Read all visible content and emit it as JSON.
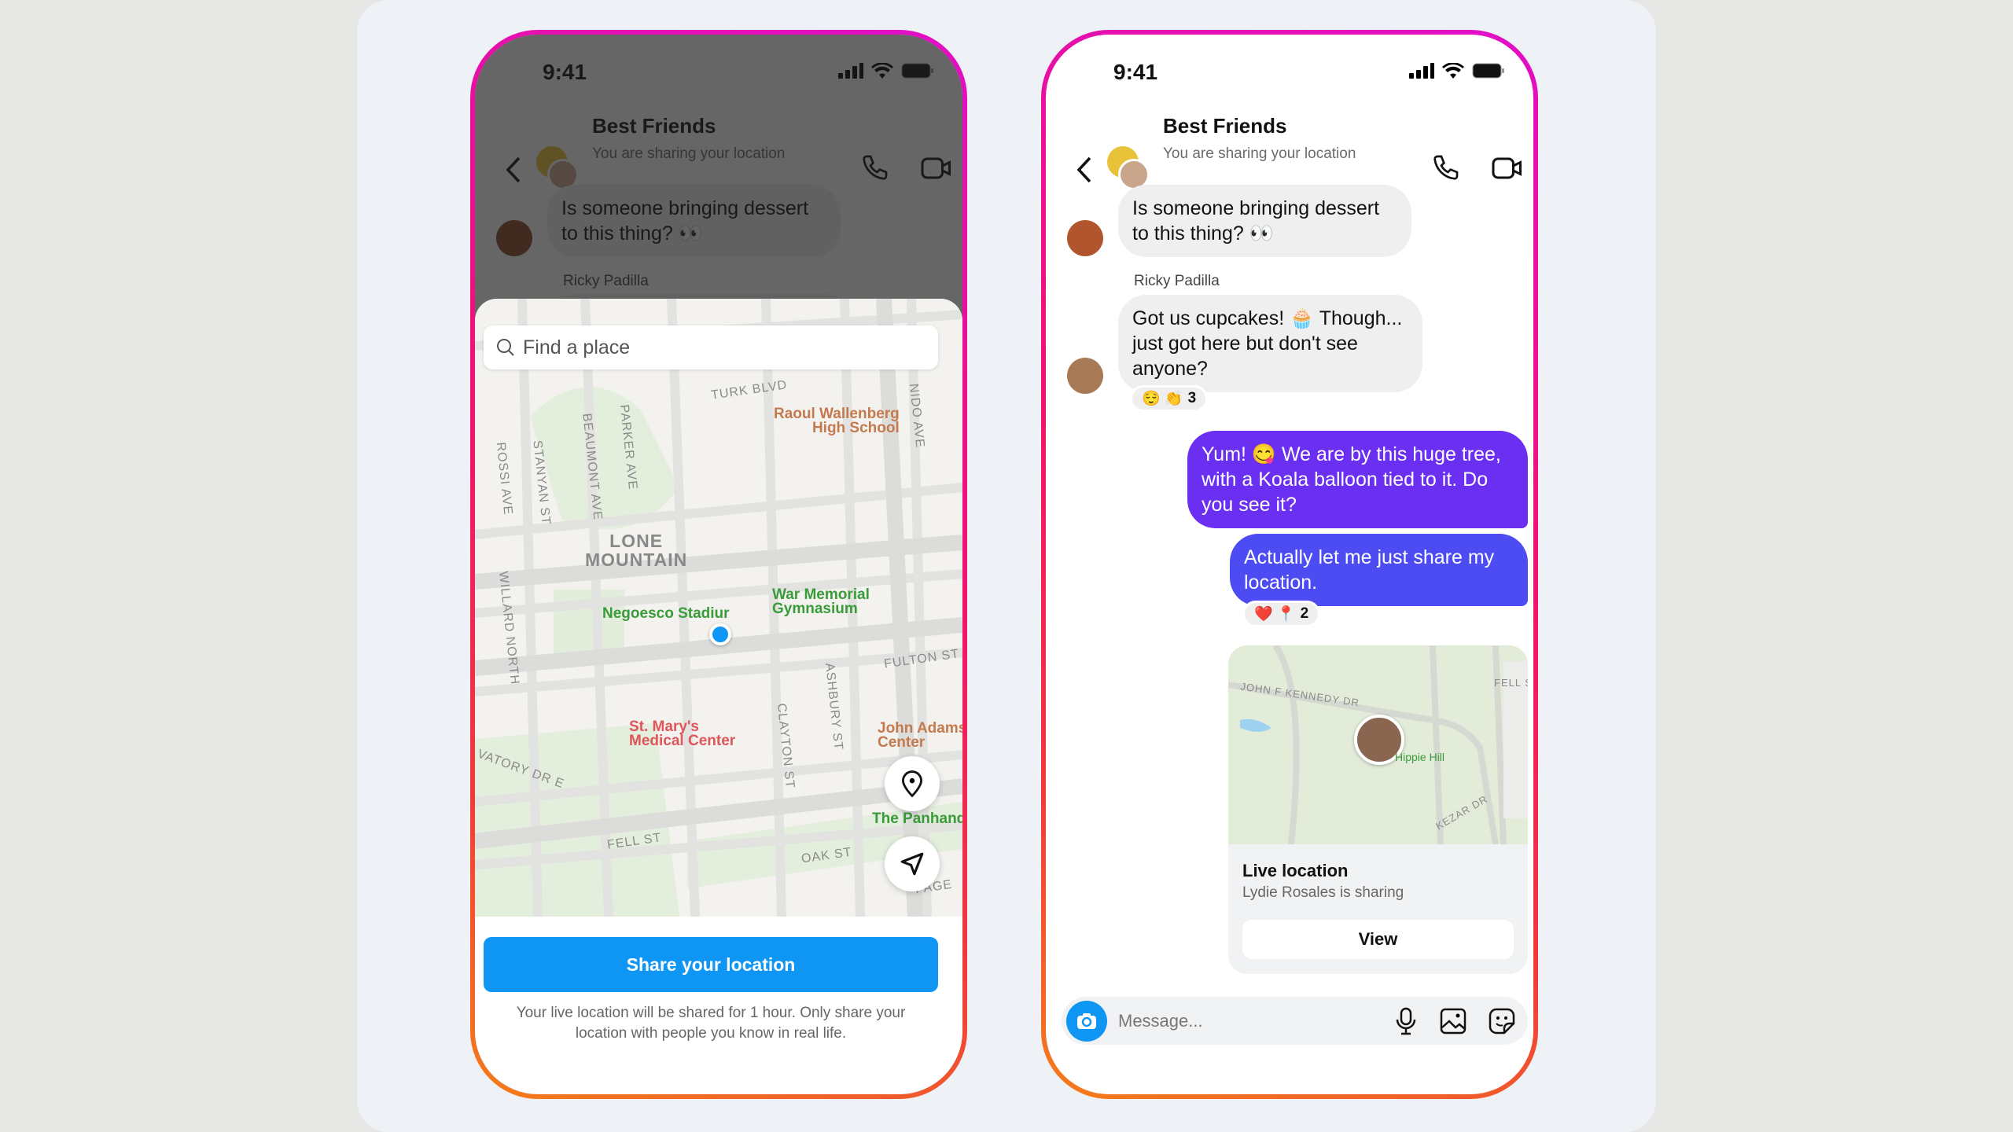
{
  "colors": {
    "accent_blue": "#0f96f5",
    "bubble_purple_1": "#6a2ff0",
    "bubble_purple_2": "#4d4cf2",
    "received_bubble": "#efefef",
    "frame_gradient": [
      "#e10fc8",
      "#f0126e",
      "#f57d1a"
    ]
  },
  "status_bar": {
    "time": "9:41",
    "icons": [
      "signal-icon",
      "wifi-icon",
      "battery-icon"
    ]
  },
  "header": {
    "title": "Best Friends",
    "subtitle": "You are sharing your location",
    "icons": [
      "back-chevron-icon",
      "phone-icon",
      "video-camera-icon"
    ]
  },
  "messages": [
    {
      "from": "other",
      "text": "Is someone bringing dessert to this thing? 👀"
    },
    {
      "from": "other",
      "sender": "Ricky Padilla",
      "text": "Got us cupcakes! 🧁 Though... just got here but don't see anyone?",
      "reactions": "😌 👏",
      "reaction_count": "3"
    },
    {
      "from": "me",
      "text": "Yum! 😋 We are by this huge tree, with a Koala balloon tied to it. Do you see it?"
    },
    {
      "from": "me",
      "text": "Actually let me just share my location.",
      "reactions": "❤️ 📍",
      "reaction_count": "2"
    }
  ],
  "share_sheet": {
    "search_placeholder": "Find a place",
    "map_labels": {
      "area": [
        "LONE",
        "MOUNTAIN"
      ],
      "streets": {
        "turk": "TURK BLVD",
        "fulton": "FULTON ST",
        "fell": "FELL ST",
        "oak": "OAK ST",
        "stanyan": "STANYAN ST",
        "beaumont": "BEAUMONT AVE",
        "parker": "PARKER AVE",
        "rossi": "ROSSI AVE",
        "nido": "NIDO AVE",
        "willard": "WILLARD NORTH",
        "clayton": "CLAYTON ST",
        "ashbury": "ASHBURY ST",
        "page": "PAGE",
        "conservatory": "VATORY DR E"
      },
      "pois": {
        "raoul": [
          "Raoul Wallenberg",
          "High School"
        ],
        "negoesco": "Negoesco Stadiur",
        "war_memorial": [
          "War Memorial",
          "Gymnasium"
        ],
        "st_marys": [
          "St. Mary's",
          "Medical Center"
        ],
        "john_adams": [
          "John Adams",
          "Center"
        ],
        "panhandle": "The Panhandl"
      }
    },
    "share_button": "Share your location",
    "disclaimer": "Your live location will be shared for 1 hour. Only share your location with people you know in real life."
  },
  "location_card": {
    "map_labels": {
      "jfk": "JOHN F KENNEDY DR",
      "fell": "FELL S",
      "hippie": "Hippie Hill",
      "kezar": "KEZAR DR"
    },
    "title": "Live location",
    "subtitle": "Lydie Rosales is sharing",
    "view_button": "View"
  },
  "composer": {
    "placeholder": "Message...",
    "icons": [
      "camera-icon",
      "microphone-icon",
      "gallery-icon",
      "sticker-icon"
    ]
  }
}
